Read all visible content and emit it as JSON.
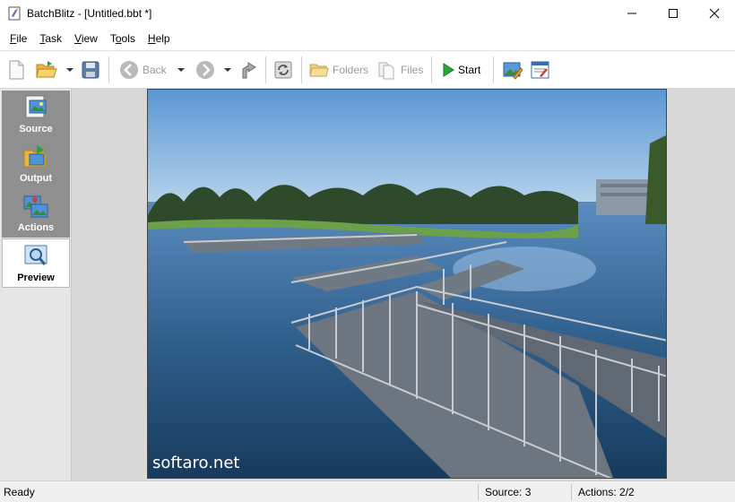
{
  "window": {
    "title": "BatchBlitz - [Untitled.bbt *]",
    "controls": [
      "minimize-icon",
      "maximize-icon",
      "close-icon"
    ]
  },
  "menu": {
    "file_pre": "",
    "file_u": "F",
    "file_post": "ile",
    "task_pre": "",
    "task_u": "T",
    "task_post": "ask",
    "view_pre": "",
    "view_u": "V",
    "view_post": "iew",
    "tools_pre": "T",
    "tools_u": "o",
    "tools_post": "ols",
    "help_pre": "",
    "help_u": "H",
    "help_post": "elp"
  },
  "toolbar": {
    "back_label": "Back",
    "folders_label": "Folders",
    "files_label": "Files",
    "start_label": "Start",
    "icons": [
      "new-file-icon",
      "open-folder-icon",
      "save-icon",
      "back-icon",
      "forward-icon",
      "export-icon",
      "refresh-icon",
      "folders-icon",
      "files-icon",
      "play-icon",
      "edit-image-icon",
      "properties-icon"
    ]
  },
  "sidebar": {
    "items": [
      {
        "label": "Source",
        "active": false
      },
      {
        "label": "Output",
        "active": false
      },
      {
        "label": "Actions",
        "active": false
      },
      {
        "label": "Preview",
        "active": true
      }
    ]
  },
  "preview": {
    "watermark": "softaro.net"
  },
  "status": {
    "ready": "Ready",
    "source": "Source: 3",
    "actions": "Actions: 2/2"
  },
  "colors": {
    "accent_green": "#2aa632",
    "sidebar_dark": "#8f8f8f",
    "sky": "#6aa4d8",
    "water": "#2f5f8c"
  }
}
